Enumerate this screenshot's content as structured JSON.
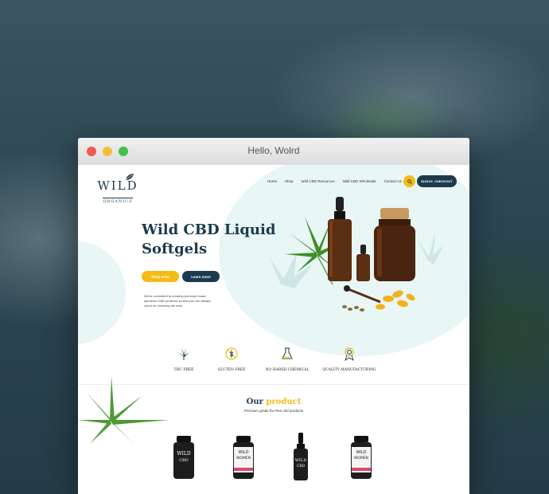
{
  "window": {
    "title": "Hello, Wolrd"
  },
  "logo": {
    "main": "WILD",
    "sub": "ORGANICS"
  },
  "nav": {
    "items": [
      "Home",
      "Shop",
      "Wild CBD Resources",
      "Wild CBD Wholesale",
      "Contact Us"
    ]
  },
  "cart": {
    "amount": "$125.00",
    "checkout": "CHECKOUT"
  },
  "hero": {
    "title": "Wild CBD Liquid Softgels",
    "shop_label": "Shop now!",
    "learn_label": "Learn more",
    "description": "We're committed to creating premium broad spectrum CBD products so that you can always count on receiving the best."
  },
  "features": [
    {
      "icon": "hemp-leaf-icon",
      "label": "THC FREE"
    },
    {
      "icon": "gluten-free-icon",
      "label": "GLUTEN FREE"
    },
    {
      "icon": "no-chemical-icon",
      "label": "NO HARSH CHEMICAL"
    },
    {
      "icon": "quality-icon",
      "label": "QUALITY MANUFACTURING"
    }
  ],
  "products": {
    "title_main": "Our",
    "title_accent": "product",
    "subtitle": "Premium grade thc-free cbd products",
    "items": [
      {
        "line1": "WILD",
        "line2": "CBD"
      },
      {
        "line1": "WILD",
        "line2": "WOMEN"
      },
      {
        "line1": "WILD",
        "line2": "CBD"
      },
      {
        "line1": "WILD",
        "line2": "WOMEN"
      }
    ]
  },
  "colors": {
    "accent": "#f5bb14",
    "primary": "#1c3a4e",
    "mint": "#e8f6f5"
  }
}
